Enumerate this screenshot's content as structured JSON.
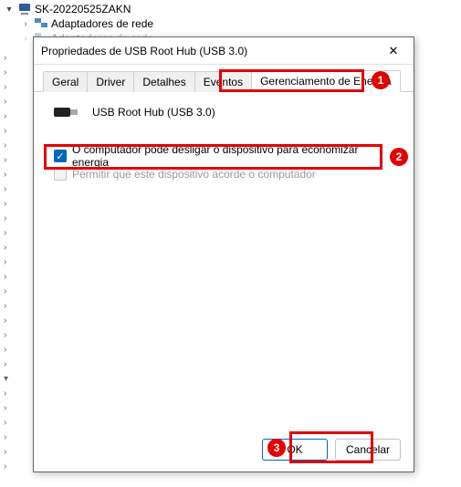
{
  "tree": {
    "root": "SK-20220525ZAKN",
    "sub1": "Adaptadores de rede",
    "sub2": "Adaptadores de rede"
  },
  "dialog": {
    "title": "Propriedades de USB Root Hub (USB 3.0)",
    "tabs": {
      "general": "Geral",
      "driver": "Driver",
      "details": "Detalhes",
      "events": "Eventos",
      "power": "Gerenciamento de Energia"
    },
    "device_name": "USB Root Hub (USB 3.0)",
    "checkbox1_label": "O computador pode desligar o dispositivo para economizar energia",
    "checkbox2_label": "Permitir que este dispositivo acorde o computador",
    "ok_label": "OK",
    "cancel_label": "Cancelar"
  },
  "annotations": {
    "b1": "1",
    "b2": "2",
    "b3": "3"
  }
}
